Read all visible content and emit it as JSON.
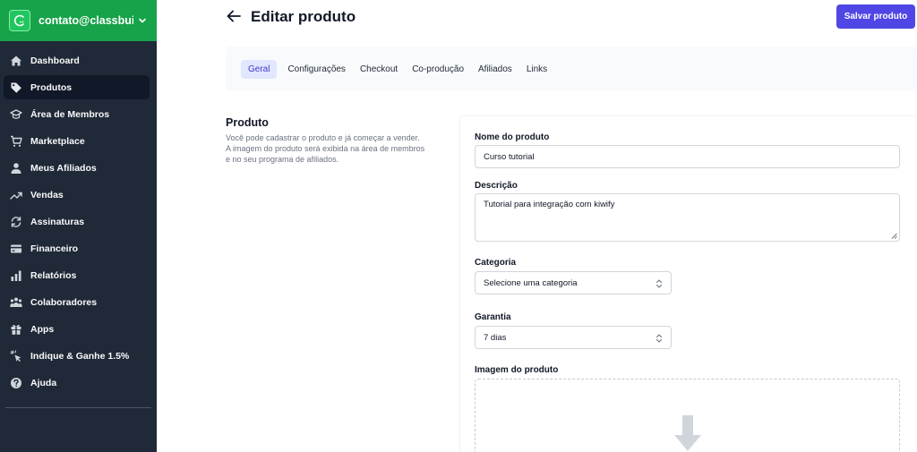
{
  "account": {
    "email": "contato@classbui..."
  },
  "sidebar": {
    "items": [
      {
        "label": "Dashboard",
        "icon": "home-icon"
      },
      {
        "label": "Produtos",
        "icon": "tag-icon",
        "active": true
      },
      {
        "label": "Área de Membros",
        "icon": "graduation-cap-icon"
      },
      {
        "label": "Marketplace",
        "icon": "cart-icon"
      },
      {
        "label": "Meus Afiliados",
        "icon": "user-icon"
      },
      {
        "label": "Vendas",
        "icon": "trending-up-icon"
      },
      {
        "label": "Assinaturas",
        "icon": "refresh-icon"
      },
      {
        "label": "Financeiro",
        "icon": "credit-card-icon"
      },
      {
        "label": "Relatórios",
        "icon": "bar-chart-icon"
      },
      {
        "label": "Colaboradores",
        "icon": "users-icon"
      },
      {
        "label": "Apps",
        "icon": "gift-icon"
      },
      {
        "label": "Indique & Ganhe 1.5%",
        "icon": "cursor-click-icon"
      },
      {
        "label": "Ajuda",
        "icon": "help-icon"
      }
    ]
  },
  "header": {
    "title": "Editar produto",
    "save_label": "Salvar produto"
  },
  "tabs": [
    {
      "label": "Geral",
      "active": true
    },
    {
      "label": "Configurações"
    },
    {
      "label": "Checkout"
    },
    {
      "label": "Co-produção"
    },
    {
      "label": "Afiliados"
    },
    {
      "label": "Links"
    }
  ],
  "section": {
    "title": "Produto",
    "description_lines": [
      "Você pode cadastrar o produto e já começar a vender.",
      "A imagem do produto será exibida na área de membros",
      "e no seu programa de afiliados."
    ]
  },
  "form": {
    "name_label": "Nome do produto",
    "name_value": "Curso tutorial",
    "description_label": "Descrição",
    "description_value": "Tutorial para integração com kiwify",
    "category_label": "Categoria",
    "category_value": "Selecione uma categoria",
    "warranty_label": "Garantia",
    "warranty_value": "7 dias",
    "image_label": "Imagem do produto"
  },
  "colors": {
    "sidebar_bg": "#1f2937",
    "account_bg": "#16a34a",
    "accent": "#4f46e5",
    "active_tab_bg": "#e0e7ff"
  }
}
